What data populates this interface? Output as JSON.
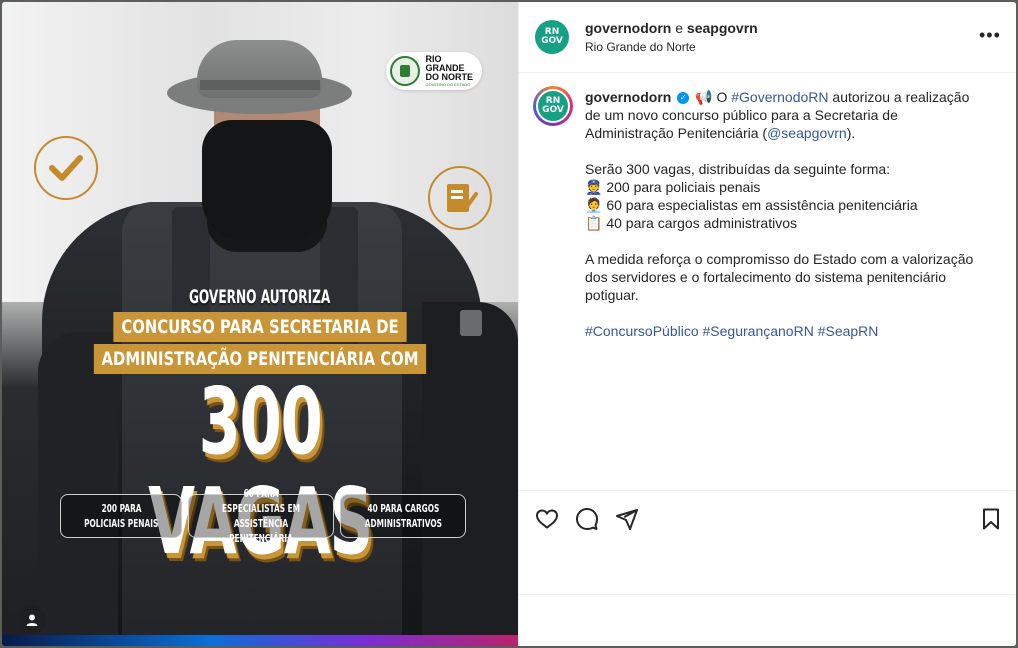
{
  "post": {
    "image": {
      "logo_line1": "RIO GRANDE",
      "logo_line2": "DO NORTE",
      "logo_sub": "GOVERNO DO ESTADO",
      "headline_top": "GOVERNO AUTORIZA",
      "headline_line2": "CONCURSO PARA SECRETARIA DE",
      "headline_line3": "ADMINISTRAÇÃO PENITENCIÁRIA COM",
      "big_text": "300 VAGAS",
      "pills": [
        {
          "line1": "200 PARA",
          "line2": "POLICIAIS PENAIS"
        },
        {
          "line1": "60 PARA ESPECIALISTAS EM",
          "line2": "ASSISTÊNCIA PENITENCIÁRIA"
        },
        {
          "line1": "40 PARA CARGOS",
          "line2": "ADMINISTRATIVOS"
        }
      ],
      "accent_gold": "#c99537"
    },
    "header": {
      "author1": "governodorn",
      "connector": "e",
      "author2": "seapgovrn",
      "location": "Rio Grande do Norte",
      "avatar_text": "RN GOV"
    },
    "caption": {
      "username": "governodorn",
      "intro_emoji": "📢",
      "line1_pre": "O ",
      "hashtag_gov": "#GovernodoRN",
      "line1_post": " autorizou a realização de um novo concurso público para a Secretaria de Administração Penitenciária (",
      "mention": "@seapgovrn",
      "line1_end": ").",
      "vacancies_intro": "Serão 300 vagas, distribuídas da seguinte forma:",
      "items": [
        {
          "emoji": "👮",
          "text": "200 para policiais penais"
        },
        {
          "emoji": "🧑‍💼",
          "text": "60 para especialistas em assistência penitenciária"
        },
        {
          "emoji": "📋",
          "text": "40 para cargos administrativos"
        }
      ],
      "closing": "A medida reforça o compromisso do Estado com a valorização dos servidores e o fortalecimento do sistema penitenciário potiguar.",
      "hashtags": "#ConcursoPúblico #SegurançanoRN #SeapRN"
    }
  }
}
